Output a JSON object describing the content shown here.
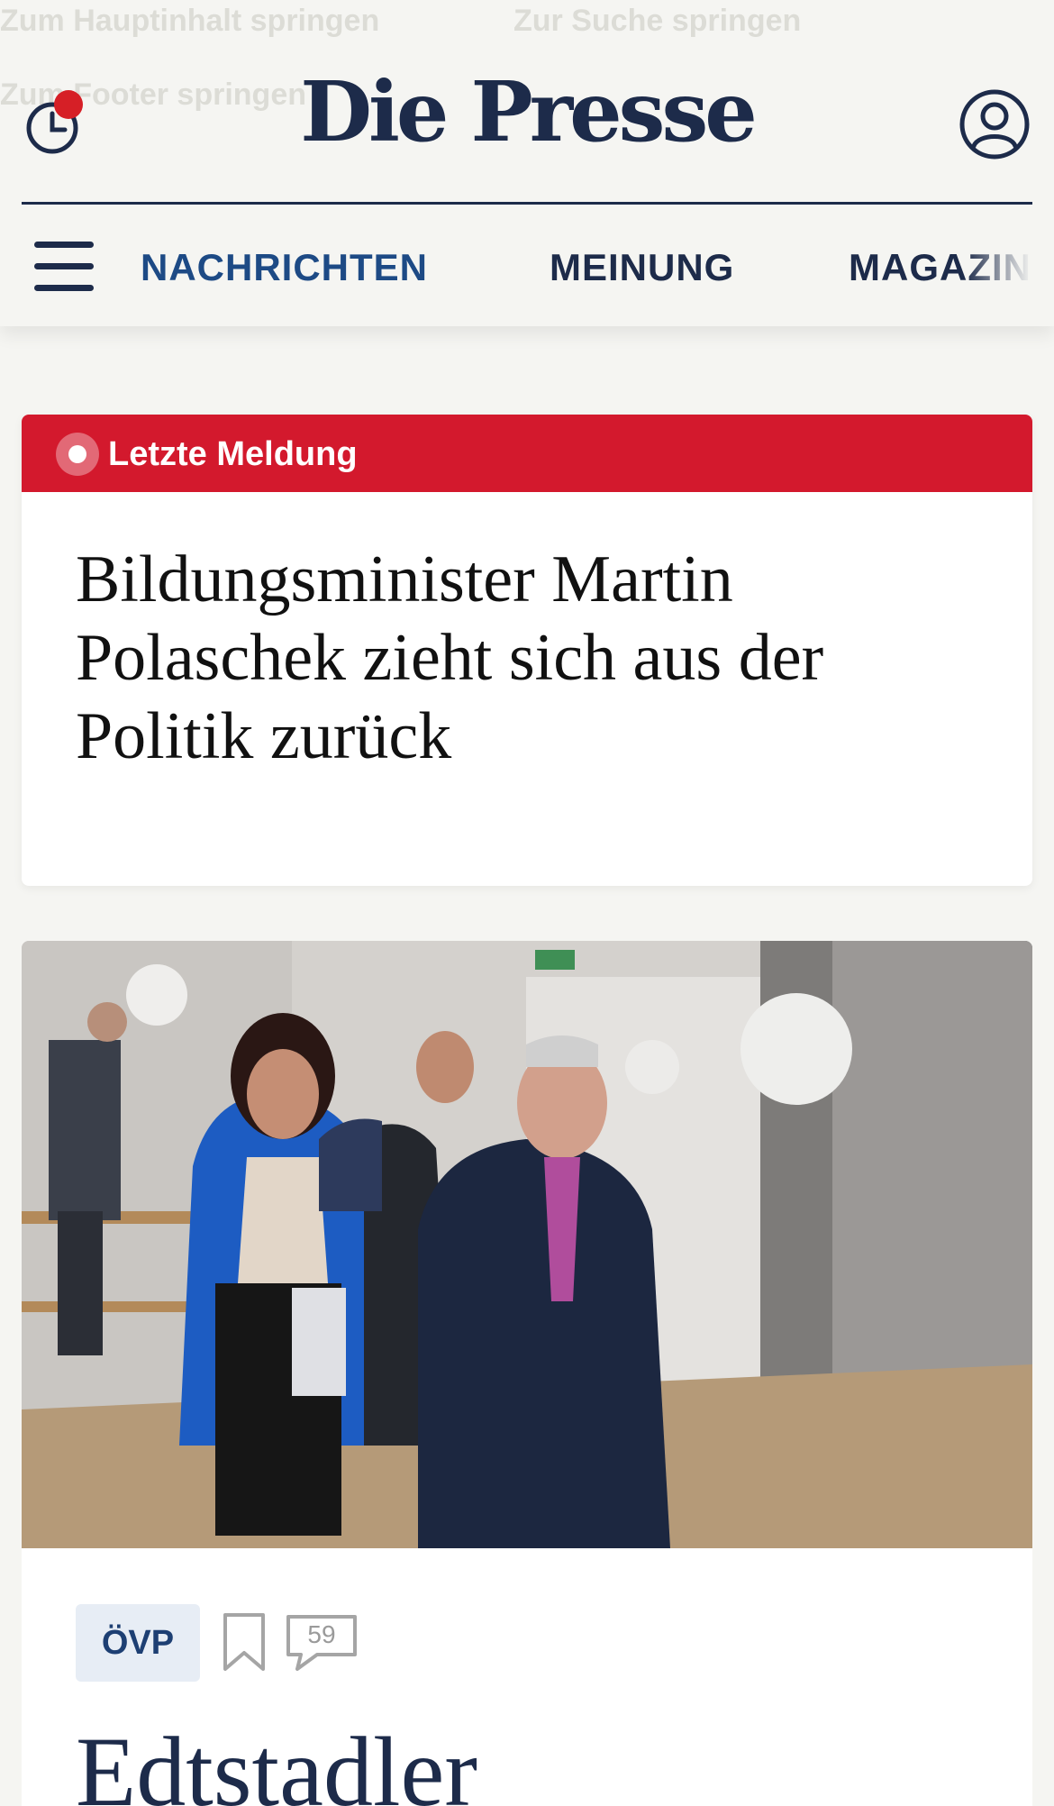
{
  "skip_links": {
    "to_content": "Zum Hauptinhalt springen",
    "to_search": "Zur Suche springen",
    "to_footer": "Zum Footer springen"
  },
  "header": {
    "logo_text": "Die Presse",
    "history_icon": "clock-icon",
    "has_notification": true,
    "account_icon": "user-circle-icon",
    "menu_icon": "hamburger-icon"
  },
  "nav": {
    "items": [
      {
        "label": "NACHRICHTEN",
        "active": true
      },
      {
        "label": "MEINUNG",
        "active": false
      },
      {
        "label": "MAGAZIN",
        "active": false
      }
    ]
  },
  "breaking": {
    "label": "Letzte Meldung",
    "headline": "Bildungsminister Martin Polaschek zieht sich aus der Politik zurück"
  },
  "article": {
    "image_description": "photo",
    "tag": "ÖVP",
    "comment_count": "59",
    "title": "Edtstadler"
  },
  "colors": {
    "brand_navy": "#1d2b4a",
    "nav_active": "#1d4a85",
    "breaking_red": "#d3192d",
    "notification_red": "#d61f26",
    "page_background": "#f5f5f2"
  }
}
